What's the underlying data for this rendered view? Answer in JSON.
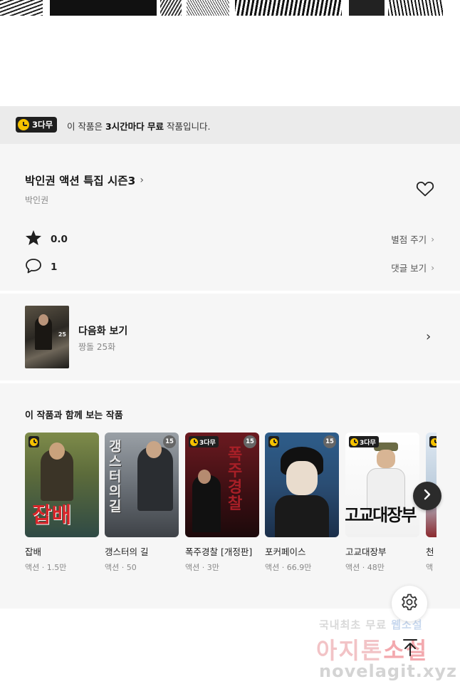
{
  "banner": {
    "badge_label": "3다무",
    "text_prefix": "이 작품은 ",
    "text_highlight": "3시간마다 무료",
    "text_suffix": " 작품입니다."
  },
  "work": {
    "title": "박인권 액션 특집 시즌3",
    "author": "박인권",
    "rating": "0.0",
    "rating_link": "별점 주기",
    "comment_count": "1",
    "comment_link": "댓글 보기"
  },
  "next_episode": {
    "title": "다음화 보기",
    "subtitle": "짱돌 25화",
    "thumb_label": "25"
  },
  "recommendations": {
    "heading": "이 작품과 함께 보는 작품",
    "items": [
      {
        "name": "잡배",
        "meta": "액션 · 1.5만",
        "badge": "clock",
        "cover_text": "잡배",
        "age": ""
      },
      {
        "name": "갱스터의 길",
        "meta": "액션 · 50",
        "badge": "",
        "cover_text": "갱스터의길",
        "age": "15"
      },
      {
        "name": "폭주경찰 [개정판]",
        "meta": "액션 · 3만",
        "badge": "3다무",
        "cover_text": "폭주경찰",
        "age": "15"
      },
      {
        "name": "포커페이스",
        "meta": "액션 · 66.9만",
        "badge": "clock",
        "cover_text": "",
        "age": "15"
      },
      {
        "name": "고교대장부",
        "meta": "액션 · 48만",
        "badge": "3다무",
        "cover_text": "고교대장부",
        "age": ""
      },
      {
        "name": "천",
        "meta": "액",
        "badge": "clock",
        "cover_text": "",
        "age": ""
      }
    ]
  },
  "watermark": {
    "line1_a": "국내최초 무료 ",
    "line1_b": "웹소설",
    "line2_a": "아지톤",
    "line2_b": "소설",
    "line3": "novelagit.xyz"
  },
  "icons": {
    "rating": "star-icon",
    "comments": "speech-bubble-icon",
    "favorite": "heart-icon",
    "settings": "gear-icon",
    "scroll_top": "arrow-up-icon",
    "scroll_next": "chevron-right-icon"
  },
  "colors": {
    "accent_yellow": "#f5c200",
    "badge_dark": "#1f1f1f",
    "panel_bg": "#f6f6f6",
    "banner_bg": "#ebebeb"
  }
}
